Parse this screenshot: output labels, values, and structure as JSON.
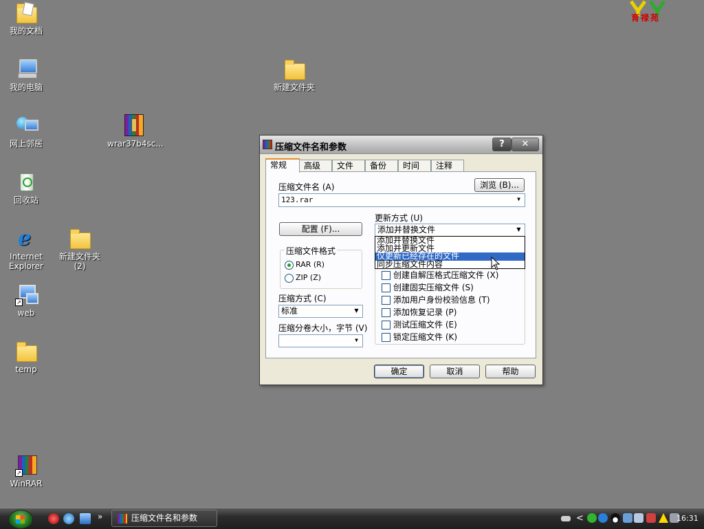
{
  "desktop": {
    "icons": [
      {
        "label": "我的文档"
      },
      {
        "label": "我的电脑"
      },
      {
        "label": "网上邻居"
      },
      {
        "label": "回收站"
      },
      {
        "label": "Internet Explorer"
      },
      {
        "label": "web"
      },
      {
        "label": "temp"
      },
      {
        "label": "WinRAR"
      },
      {
        "label": "新建文件夹"
      },
      {
        "label": "wrar37b4sc..."
      },
      {
        "label": "新建文件夹 (2)"
      }
    ],
    "logo_text": "育禄苑"
  },
  "dialog": {
    "title": "压缩文件名和参数",
    "help_glyph": "?",
    "close_glyph": "✕",
    "tabs": [
      "常规",
      "高级",
      "文件",
      "备份",
      "时间",
      "注释"
    ],
    "archive_name_label": "压缩文件名 (A)",
    "archive_name_value": "123.rar",
    "browse_button": "浏览 (B)...",
    "profiles_button": "配置 (F)...",
    "update_mode_label": "更新方式 (U)",
    "update_mode_value": "添加并替换文件",
    "update_mode_options": [
      {
        "label": "添加并替换文件",
        "selected": false
      },
      {
        "label": "添加并更新文件",
        "selected": false
      },
      {
        "label": "仅更新已经存在的文件",
        "selected": true
      },
      {
        "label": "同步压缩文件内容",
        "selected": false
      }
    ],
    "format_group_label": "压缩文件格式",
    "format_options": [
      {
        "label": "RAR (R)",
        "checked": true
      },
      {
        "label": "ZIP (Z)",
        "checked": false
      }
    ],
    "method_label": "压缩方式 (C)",
    "method_value": "标准",
    "volume_label": "压缩分卷大小，字节 (V)",
    "volume_value": "",
    "options": [
      {
        "label": "创建自解压格式压缩文件 (X)",
        "checked": false
      },
      {
        "label": "创建固实压缩文件 (S)",
        "checked": false
      },
      {
        "label": "添加用户身份校验信息 (T)",
        "checked": false
      },
      {
        "label": "添加恢复记录 (P)",
        "checked": false
      },
      {
        "label": "测试压缩文件 (E)",
        "checked": false
      },
      {
        "label": "锁定压缩文件 (K)",
        "checked": false
      }
    ],
    "ok_button": "确定",
    "cancel_button": "取消",
    "help_button": "帮助"
  },
  "taskbar": {
    "active_task": "压缩文件名和参数",
    "quicklaunch_more": "»",
    "tray_collapse": "<",
    "clock": "16:31"
  },
  "colors": {
    "desktop_bg": "#7f7f7f",
    "selection": "#316ac5",
    "dialog_bg": "#ece9d8"
  }
}
